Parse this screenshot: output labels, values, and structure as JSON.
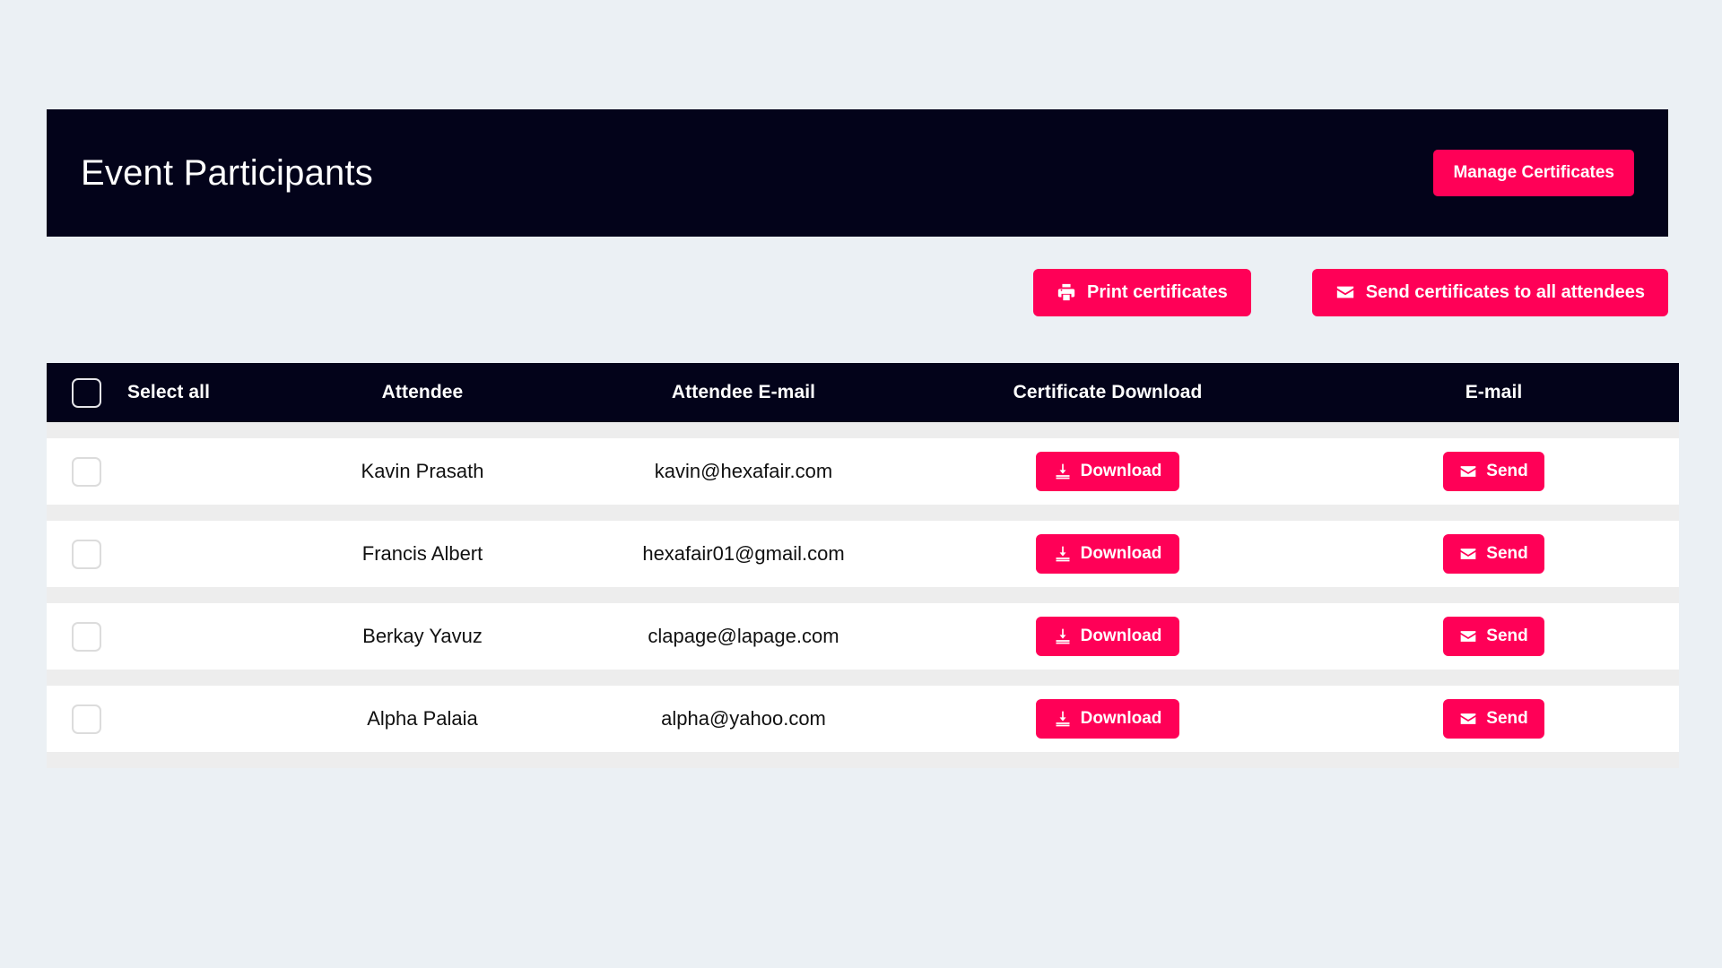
{
  "page": {
    "background_color": "#ebf0f4",
    "accent_color": "#ff0057",
    "dark_color": "#03031a"
  },
  "header": {
    "title": "Event Participants",
    "manage_certificates_label": "Manage Certificates"
  },
  "action_bar": {
    "print_label": "Print certificates",
    "print_icon": "printer-icon",
    "send_all_label": "Send certificates to all attendees",
    "send_all_icon": "envelope-icon"
  },
  "table": {
    "columns": {
      "select_all": "Select all",
      "attendee": "Attendee",
      "attendee_email": "Attendee E-mail",
      "certificate_download": "Certificate Download",
      "email": "E-mail"
    },
    "select_all_checked": false,
    "download_label": "Download",
    "download_icon": "download-icon",
    "send_label": "Send",
    "send_icon": "envelope-icon",
    "rows": [
      {
        "checked": false,
        "attendee": "Kavin Prasath",
        "email": "kavin@hexafair.com"
      },
      {
        "checked": false,
        "attendee": "Francis Albert",
        "email": "hexafair01@gmail.com"
      },
      {
        "checked": false,
        "attendee": "Berkay Yavuz",
        "email": "clapage@lapage.com"
      },
      {
        "checked": false,
        "attendee": "Alpha Palaia",
        "email": "alpha@yahoo.com"
      }
    ]
  }
}
